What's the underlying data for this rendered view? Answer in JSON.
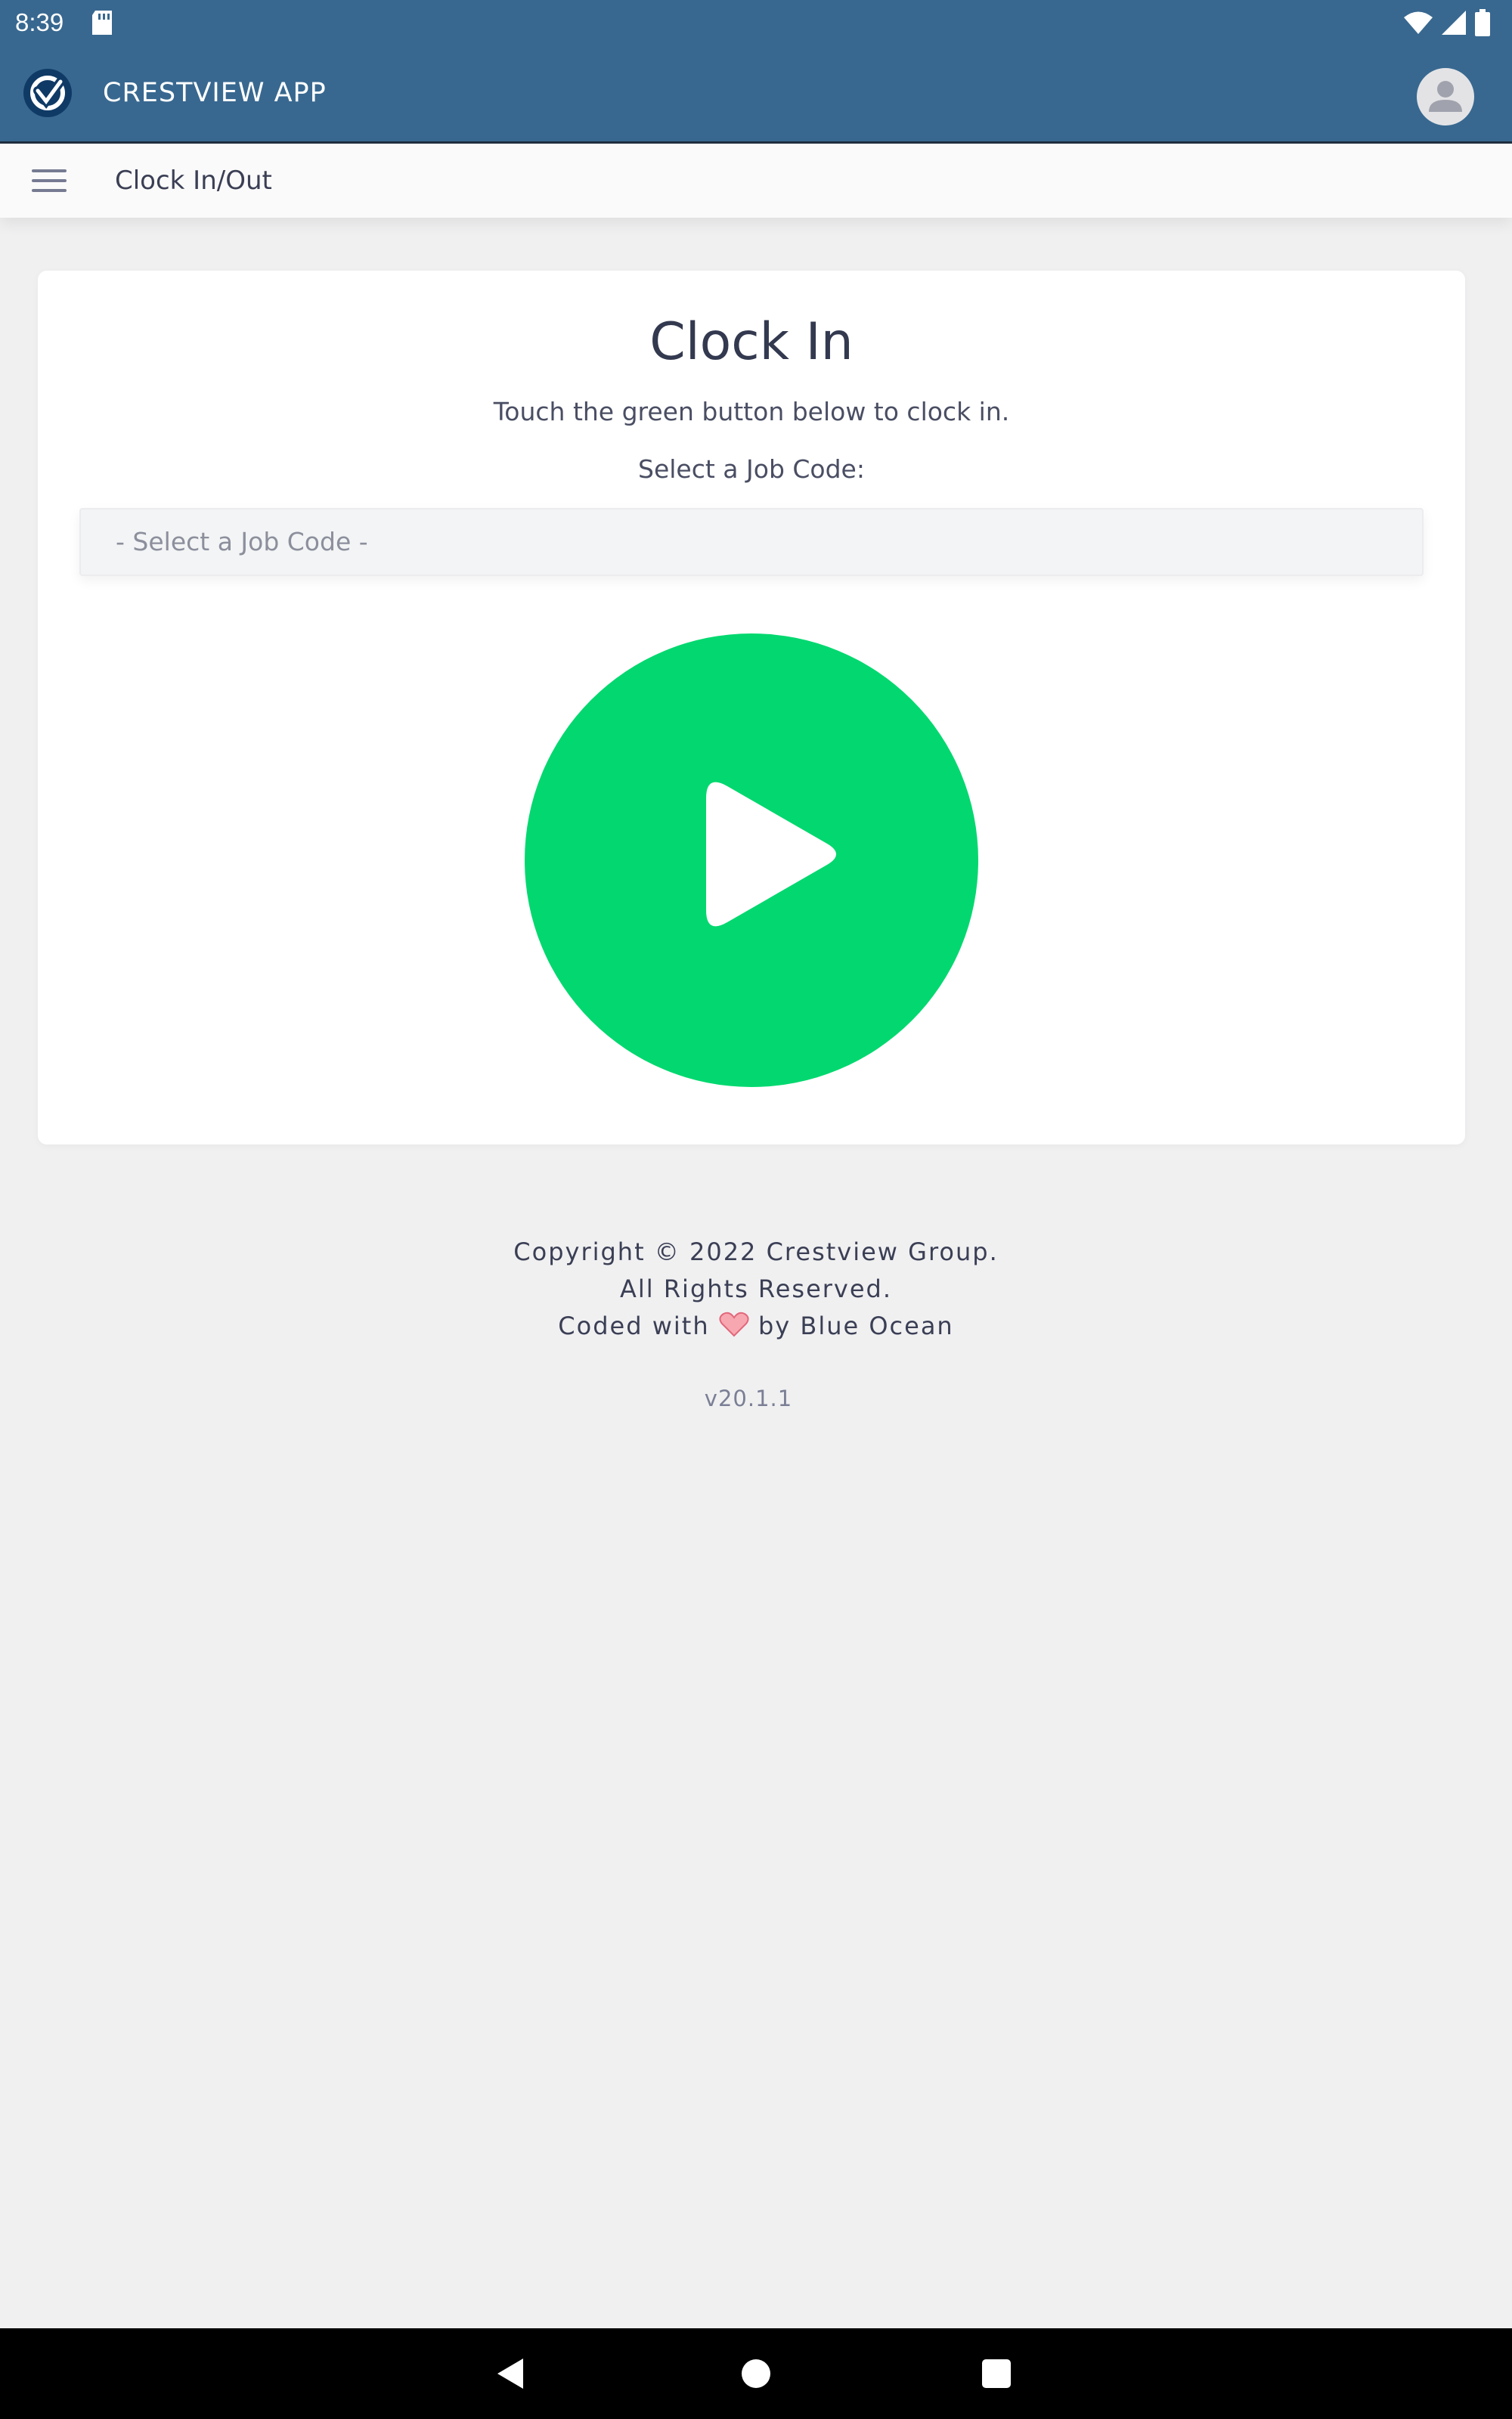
{
  "status_bar": {
    "time": "8:39",
    "icons": [
      "sd-card-icon",
      "wifi-icon",
      "signal-icon",
      "battery-icon"
    ]
  },
  "app_bar": {
    "title": "CRESTVIEW APP",
    "logo_icon": "crestview-logo-icon",
    "avatar_icon": "user-avatar-icon"
  },
  "sub_bar": {
    "menu_icon": "hamburger-menu-icon",
    "breadcrumb": "Clock In/Out"
  },
  "clock_card": {
    "title": "Clock In",
    "hint": "Touch the green button below to clock in.",
    "job_code_label": "Select a Job Code:",
    "job_code_placeholder": "- Select a Job Code -",
    "play_icon": "play-icon",
    "button_color": "#02d86f"
  },
  "footer": {
    "line1": "Copyright © 2022 Crestview Group.",
    "line2": "All Rights Reserved.",
    "line3_prefix": "Coded with",
    "line3_suffix": "by Blue Ocean",
    "heart_icon": "heart-icon",
    "version": "v20.1.1"
  },
  "nav_bar": {
    "icons": [
      "back-icon",
      "home-icon",
      "recents-icon"
    ]
  },
  "colors": {
    "header": "#386890",
    "accent_green": "#02d86f",
    "background": "#f0f0f1"
  }
}
